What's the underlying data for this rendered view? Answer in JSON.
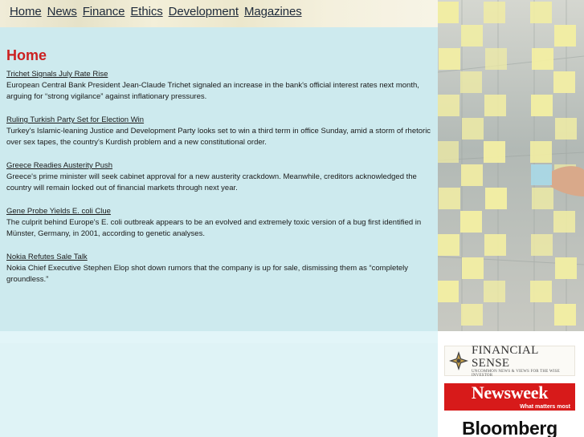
{
  "nav": {
    "items": [
      "Home",
      "News",
      "Finance",
      "Ethics",
      "Development",
      "Magazines"
    ]
  },
  "page_title": "Home",
  "articles": [
    {
      "headline": "Trichet Signals July Rate Rise",
      "summary": "European Central Bank President Jean-Claude Trichet signaled an increase in the bank's official interest rates next month, arguing for “strong vigilance” against inflationary pressures."
    },
    {
      "headline": "Ruling Turkish Party Set for Election Win",
      "summary": "Turkey's Islamic-leaning Justice and Development Party looks set to win a third term in office Sunday, amid a storm of rhetoric over sex tapes, the country's Kurdish problem and a new constitutional order."
    },
    {
      "headline": "Greece Readies Austerity Push",
      "summary": "Greece's prime minister will seek cabinet approval for a new austerity crackdown. Meanwhile, creditors acknowledged the country will remain locked out of financial markets through next year."
    },
    {
      "headline": "Gene Probe Yields E. coli Clue",
      "summary": "The culprit behind Europe's E. coli outbreak appears to be an evolved and extremely toxic version of a bug first identified in Münster, Germany, in 2001, according to genetic analyses."
    },
    {
      "headline": "Nokia Refutes Sale Talk",
      "summary": "Nokia Chief Executive Stephen Elop shot down rumors that the company is up for sale, dismissing them as “completely groundless.”"
    }
  ],
  "sidebar": {
    "logos": {
      "financial_sense": {
        "name": "FINANCIAL SENSE",
        "tagline": "UNCOMMON NEWS & VIEWS FOR THE WISE INVESTOR"
      },
      "newsweek": {
        "name": "Newsweek",
        "tagline": "What matters most"
      },
      "bloomberg": {
        "name": "Bloomberg"
      }
    }
  },
  "colors": {
    "title_red": "#cc2020",
    "main_bg": "#cdeaee",
    "newsweek_red": "#d71a1a"
  }
}
